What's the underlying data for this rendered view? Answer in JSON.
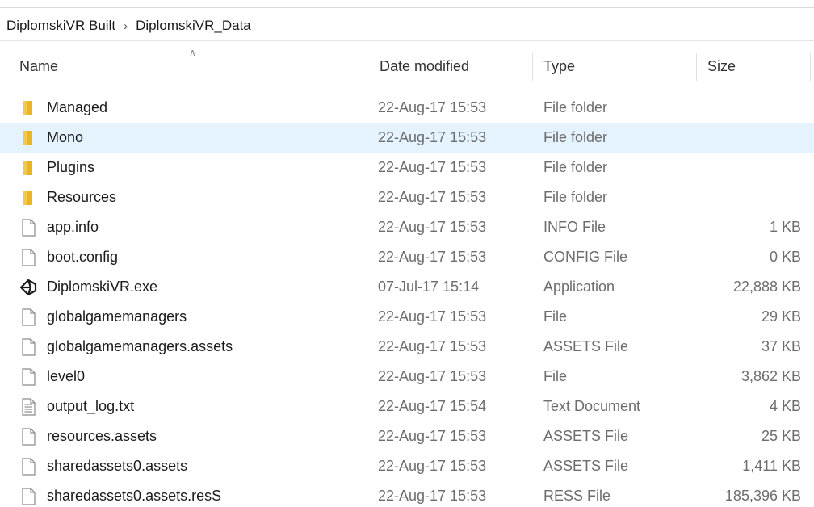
{
  "breadcrumb": {
    "items": [
      "DiplomskiVR Built",
      "DiplomskiVR_Data"
    ],
    "separator": ">"
  },
  "columns": {
    "name": "Name",
    "date": "Date modified",
    "type": "Type",
    "size": "Size"
  },
  "colors": {
    "folder": "#e8b628",
    "selection": "#e5f3ff",
    "muted_text": "#6d6d6d"
  },
  "files": [
    {
      "name": "Managed",
      "date": "22-Aug-17 15:53",
      "type": "File folder",
      "size": "",
      "icon": "folder-icon"
    },
    {
      "name": "Mono",
      "date": "22-Aug-17 15:53",
      "type": "File folder",
      "size": "",
      "icon": "folder-icon",
      "selected": true
    },
    {
      "name": "Plugins",
      "date": "22-Aug-17 15:53",
      "type": "File folder",
      "size": "",
      "icon": "folder-icon"
    },
    {
      "name": "Resources",
      "date": "22-Aug-17 15:53",
      "type": "File folder",
      "size": "",
      "icon": "folder-icon"
    },
    {
      "name": "app.info",
      "date": "22-Aug-17 15:53",
      "type": "INFO File",
      "size": "1 KB",
      "icon": "file-icon"
    },
    {
      "name": "boot.config",
      "date": "22-Aug-17 15:53",
      "type": "CONFIG File",
      "size": "0 KB",
      "icon": "file-icon"
    },
    {
      "name": "DiplomskiVR.exe",
      "date": "07-Jul-17 15:14",
      "type": "Application",
      "size": "22,888 KB",
      "icon": "unity-app-icon"
    },
    {
      "name": "globalgamemanagers",
      "date": "22-Aug-17 15:53",
      "type": "File",
      "size": "29 KB",
      "icon": "file-icon"
    },
    {
      "name": "globalgamemanagers.assets",
      "date": "22-Aug-17 15:53",
      "type": "ASSETS File",
      "size": "37 KB",
      "icon": "file-icon"
    },
    {
      "name": "level0",
      "date": "22-Aug-17 15:53",
      "type": "File",
      "size": "3,862 KB",
      "icon": "file-icon"
    },
    {
      "name": "output_log.txt",
      "date": "22-Aug-17 15:54",
      "type": "Text Document",
      "size": "4 KB",
      "icon": "text-file-icon"
    },
    {
      "name": "resources.assets",
      "date": "22-Aug-17 15:53",
      "type": "ASSETS File",
      "size": "25 KB",
      "icon": "file-icon"
    },
    {
      "name": "sharedassets0.assets",
      "date": "22-Aug-17 15:53",
      "type": "ASSETS File",
      "size": "1,411 KB",
      "icon": "file-icon"
    },
    {
      "name": "sharedassets0.assets.resS",
      "date": "22-Aug-17 15:53",
      "type": "RESS File",
      "size": "185,396 KB",
      "icon": "file-icon"
    }
  ]
}
